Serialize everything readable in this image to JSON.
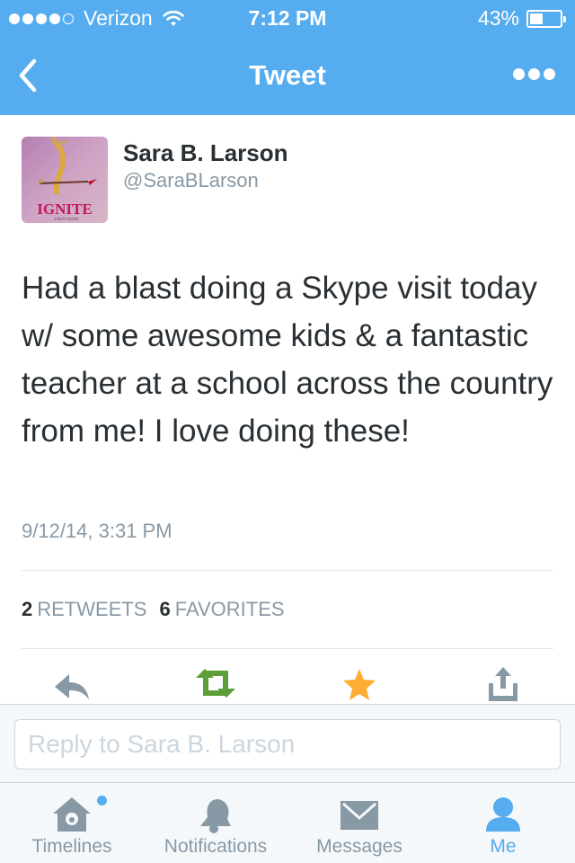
{
  "status_bar": {
    "carrier": "Verizon",
    "time": "7:12 PM",
    "battery_text": "43%",
    "battery_level": 0.43,
    "signal_bars_filled": 4,
    "signal_bars_total": 5
  },
  "nav": {
    "title": "Tweet",
    "back_icon": "chevron-left-icon",
    "more_icon": "more-dots-icon"
  },
  "tweet": {
    "author_name": "Sara B. Larson",
    "author_handle": "@SaraBLarson",
    "avatar_caption": "IGNITE",
    "avatar_subcaption": "A DEFY NOVEL",
    "text": "Had a blast doing a Skype visit today w/ some awesome kids & a fantastic teacher at a school across the country from me! I love doing these!",
    "timestamp": "9/12/14, 3:31 PM",
    "retweet_count": "2",
    "retweet_label": "RETWEETS",
    "favorite_count": "6",
    "favorite_label": "FAVORITES"
  },
  "actions": [
    {
      "name": "reply",
      "icon": "reply-icon",
      "color": "#8899a6"
    },
    {
      "name": "retweet",
      "icon": "retweet-icon",
      "color": "#5c9f3a"
    },
    {
      "name": "favorite",
      "icon": "star-icon",
      "color": "#ffac33"
    },
    {
      "name": "share",
      "icon": "share-icon",
      "color": "#8899a6"
    }
  ],
  "reply": {
    "placeholder": "Reply to Sara B. Larson"
  },
  "tabs": [
    {
      "label": "Timelines",
      "icon": "home-icon",
      "active": false,
      "has_badge": true
    },
    {
      "label": "Notifications",
      "icon": "bell-icon",
      "active": false
    },
    {
      "label": "Messages",
      "icon": "envelope-icon",
      "active": false
    },
    {
      "label": "Me",
      "icon": "person-icon",
      "active": true
    }
  ],
  "colors": {
    "brand": "#55acee",
    "text": "#292f33",
    "muted": "#8899a6",
    "retweet": "#5c9f3a",
    "favorite": "#ffac33"
  }
}
